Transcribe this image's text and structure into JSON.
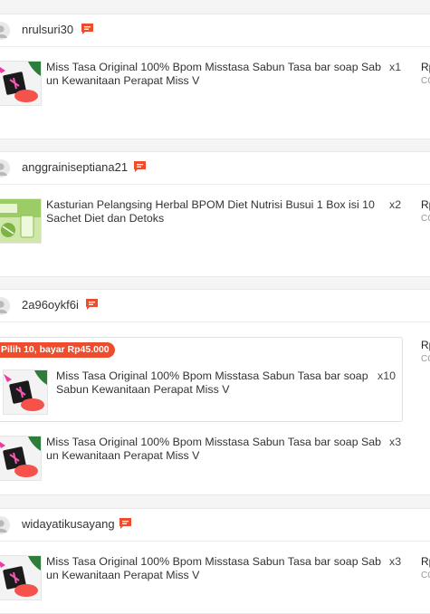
{
  "orders": [
    {
      "username": "nrulsuri30",
      "items": [
        {
          "name": "Miss Tasa Original 100% Bpom Misstasa Sabun Tasa bar soap Sab un Kewanitaan Perapat Miss V",
          "qty": "x1",
          "price": "Rp",
          "price_sub": "CO"
        }
      ]
    },
    {
      "username": "anggrainiseptiana21",
      "items": [
        {
          "name": "Kasturian Pelangsing Herbal BPOM Diet Nutrisi Busui 1 Box isi 10 Sachet Diet dan Detoks",
          "qty": "x2",
          "price": "Rp",
          "price_sub": "CO"
        }
      ]
    },
    {
      "username": "2a96oykf6i",
      "bundle": {
        "badge": "Pilih 10, bayar Rp45.000",
        "item": {
          "name": "Miss Tasa Original 100% Bpom Misstasa Sabun Tasa bar soap Sabun Kewanitaan Perapat Miss V",
          "qty": "x10"
        }
      },
      "price": "Rp",
      "price_sub": "CO",
      "items": [
        {
          "name": "Miss Tasa Original 100% Bpom Misstasa Sabun Tasa bar soap Sab un Kewanitaan Perapat Miss V",
          "qty": "x3"
        }
      ]
    },
    {
      "username": "widayatikusayang",
      "items": [
        {
          "name": "Miss Tasa Original 100% Bpom Misstasa Sabun Tasa bar soap Sab un Kewanitaan Perapat Miss V",
          "qty": "x3",
          "price": "Rp",
          "price_sub": "CO"
        }
      ]
    }
  ],
  "colors": {
    "accent": "#ee4d2d",
    "avatar_bg": "#e9e9e9",
    "page_bg": "#f5f5f5"
  },
  "icons": {
    "chat": "chat-bubble-icon",
    "avatar": "user-avatar-icon",
    "product": "product-thumbnail"
  }
}
